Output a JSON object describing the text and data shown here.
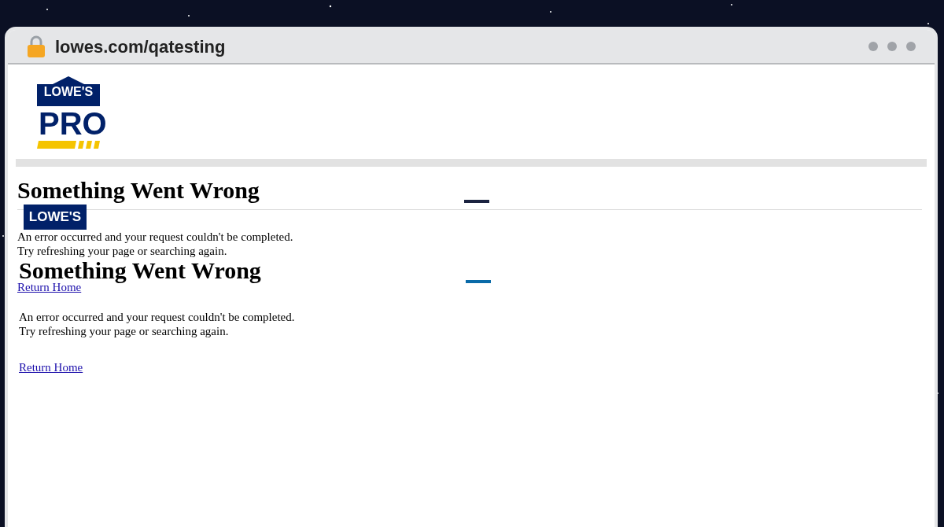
{
  "browser": {
    "url": "lowes.com/qatesting"
  },
  "header": {
    "logo": {
      "brand": "LOWE'S",
      "tier": "PRO"
    }
  },
  "layers": [
    {
      "title": "Something Went Wrong",
      "message": [
        "An error occurred and your request couldn't be completed.",
        "Try refreshing your page or searching again."
      ],
      "link": "Return Home"
    },
    {
      "logo": "LOWE'S",
      "title": "Something Went Wrong",
      "message": [
        "An error occurred and your request couldn't be completed.",
        "Try refreshing your page or searching again."
      ],
      "link": "Return Home"
    }
  ]
}
